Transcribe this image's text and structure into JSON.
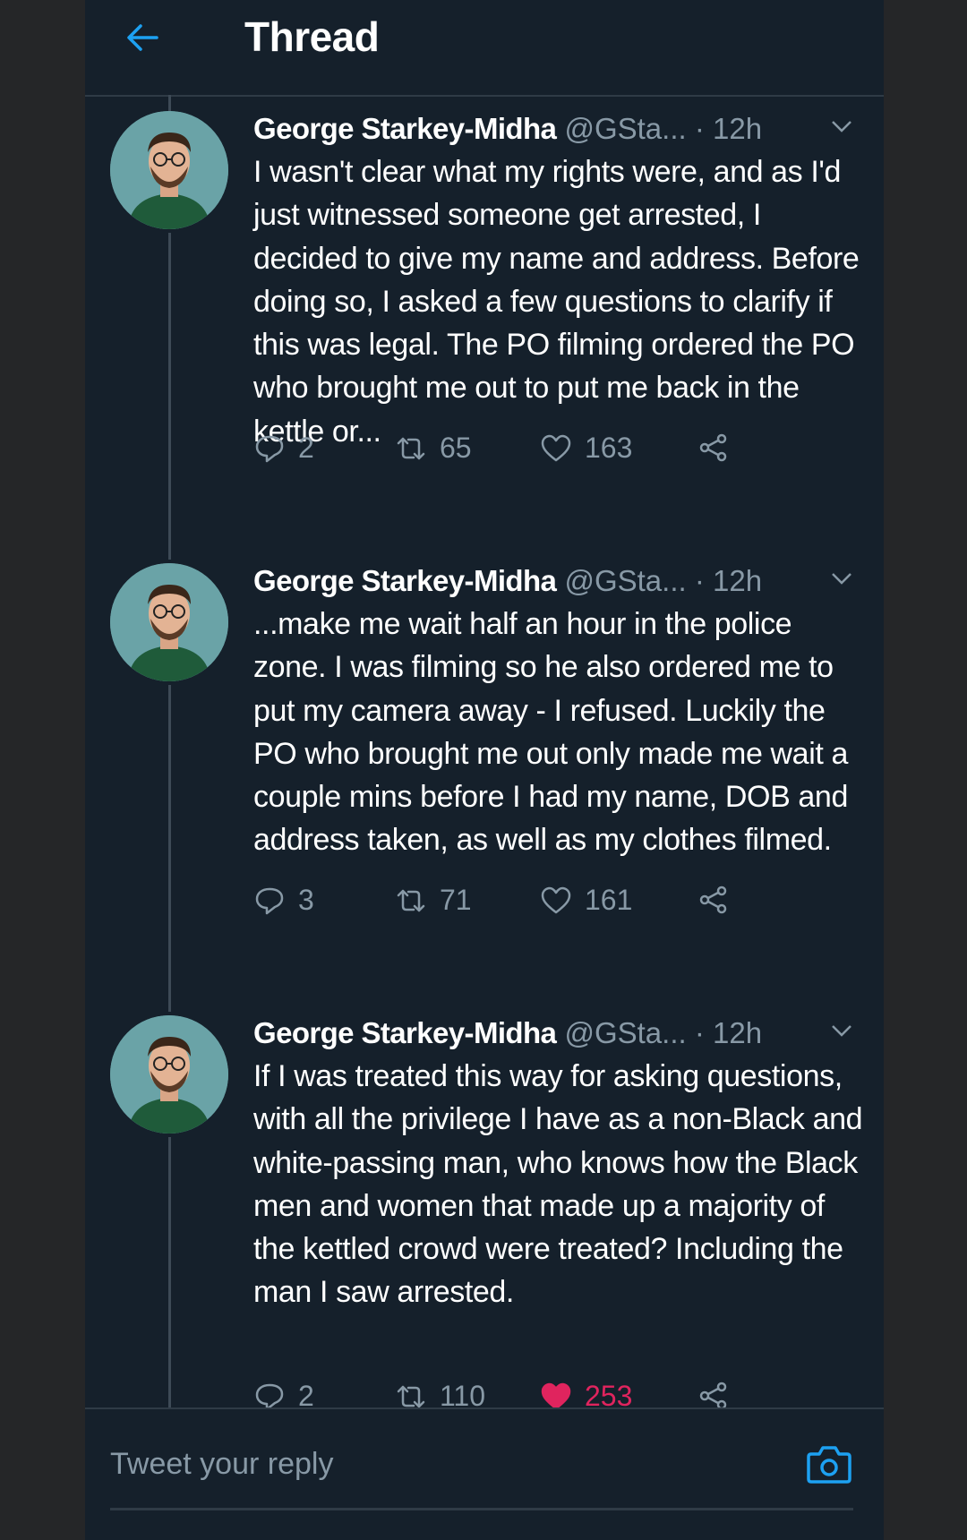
{
  "header": {
    "title": "Thread",
    "back_icon": "back-arrow-icon"
  },
  "colors": {
    "accent": "#1da1f2",
    "like": "#e0245e",
    "background": "#15202b",
    "muted": "#8899a6"
  },
  "tweets": [
    {
      "name": "George Starkey-Midha",
      "handle": "@GSta...",
      "dot": "·",
      "time": "12h",
      "text": "I wasn't clear what my rights were, and as I'd just witnessed someone get arrested, I decided to give my name and address. Before doing so, I asked a few questions to clarify if this was legal. The PO filming ordered the PO who brought me out to put me back in the kettle or...",
      "replies": "2",
      "retweets": "65",
      "likes": "163",
      "liked": false
    },
    {
      "name": "George Starkey-Midha",
      "handle": "@GSta...",
      "dot": "·",
      "time": "12h",
      "text": "...make me wait half an hour in the police zone. I was filming so he also ordered me to put my camera away - I refused. Luckily the PO who brought me out only made me wait a couple mins before I had my name, DOB and address taken, as well as my clothes filmed.",
      "replies": "3",
      "retweets": "71",
      "likes": "161",
      "liked": false
    },
    {
      "name": "George Starkey-Midha",
      "handle": "@GSta...",
      "dot": "·",
      "time": "12h",
      "text": "If I was treated this way for asking questions, with all the privilege I have as a non-Black and white-passing man, who knows how the Black men and women that made up a majority of the kettled crowd were treated? Including the man I saw arrested.",
      "replies": "2",
      "retweets": "110",
      "likes": "253",
      "liked": true
    }
  ],
  "reply": {
    "placeholder": "Tweet your reply",
    "camera_icon": "camera-icon"
  }
}
